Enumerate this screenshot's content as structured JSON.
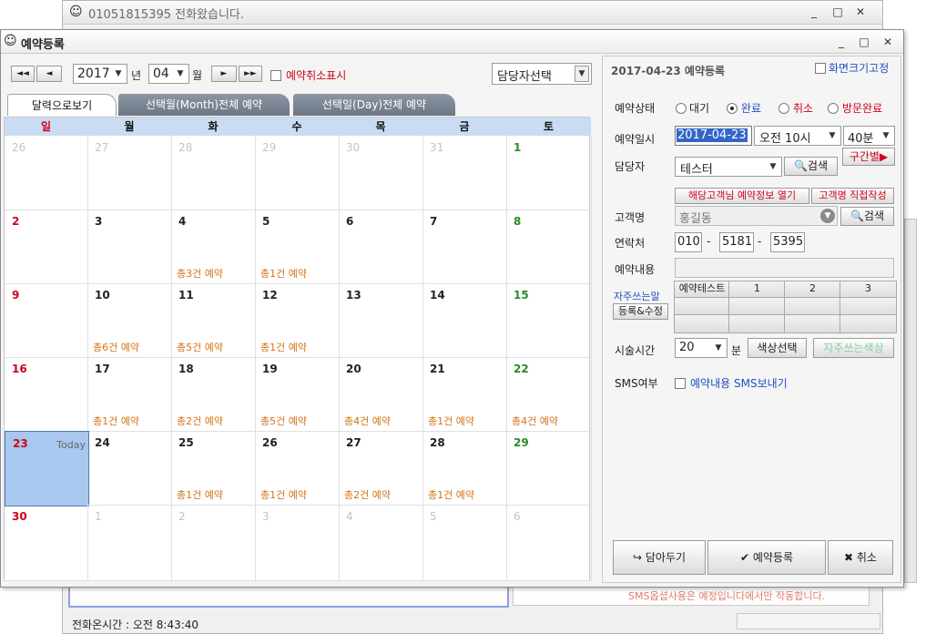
{
  "bg_window": {
    "title": "01051815395 전화왔습니다.",
    "status_label": "전화온시간 : 오전 8:43:40",
    "notice_text": "SMS옵셥사용은 예정입니다에서만 작동합니다."
  },
  "dialog": {
    "title": "예약등록",
    "controls": {
      "minimize": "_",
      "maximize": "□",
      "close": "✕"
    }
  },
  "toolbar": {
    "first_btn": "◄◄",
    "prev_btn": "◄",
    "year": "2017",
    "year_suffix": "년",
    "month": "04",
    "month_suffix": "월",
    "next_btn": "►",
    "last_btn": "►►",
    "cancel_show_label": "예약취소표시",
    "staff_select": "담당자선택"
  },
  "tabs": [
    {
      "label": "달력으로보기"
    },
    {
      "label": "선택월(Month)전체 예약"
    },
    {
      "label": "선택일(Day)전체 예약"
    }
  ],
  "calendar": {
    "weekdays": [
      "일",
      "월",
      "화",
      "수",
      "목",
      "금",
      "토"
    ],
    "weeks": [
      [
        {
          "d": "26",
          "m": "o"
        },
        {
          "d": "27",
          "m": "o"
        },
        {
          "d": "28",
          "m": "o"
        },
        {
          "d": "29",
          "m": "o"
        },
        {
          "d": "30",
          "m": "o"
        },
        {
          "d": "31",
          "m": "o"
        },
        {
          "d": "1",
          "m": "c"
        }
      ],
      [
        {
          "d": "2",
          "m": "c"
        },
        {
          "d": "3",
          "m": "c"
        },
        {
          "d": "4",
          "m": "c",
          "e": "총3건 예약"
        },
        {
          "d": "5",
          "m": "c",
          "e": "총1건 예약"
        },
        {
          "d": "6",
          "m": "c"
        },
        {
          "d": "7",
          "m": "c"
        },
        {
          "d": "8",
          "m": "c"
        }
      ],
      [
        {
          "d": "9",
          "m": "c"
        },
        {
          "d": "10",
          "m": "c",
          "e": "총6건 예약"
        },
        {
          "d": "11",
          "m": "c",
          "e": "총5건 예약"
        },
        {
          "d": "12",
          "m": "c",
          "e": "총1건 예약"
        },
        {
          "d": "13",
          "m": "c"
        },
        {
          "d": "14",
          "m": "c"
        },
        {
          "d": "15",
          "m": "c"
        }
      ],
      [
        {
          "d": "16",
          "m": "c"
        },
        {
          "d": "17",
          "m": "c",
          "e": "총1건 예약"
        },
        {
          "d": "18",
          "m": "c",
          "e": "총2건 예약"
        },
        {
          "d": "19",
          "m": "c",
          "e": "총5건 예약"
        },
        {
          "d": "20",
          "m": "c",
          "e": "총4건 예약"
        },
        {
          "d": "21",
          "m": "c",
          "e": "총1건 예약"
        },
        {
          "d": "22",
          "m": "c",
          "e": "총4건 예약"
        }
      ],
      [
        {
          "d": "23",
          "m": "c",
          "t": "Today"
        },
        {
          "d": "24",
          "m": "c"
        },
        {
          "d": "25",
          "m": "c",
          "e": "총1건 예약"
        },
        {
          "d": "26",
          "m": "c",
          "e": "총1건 예약"
        },
        {
          "d": "27",
          "m": "c",
          "e": "총2건 예약"
        },
        {
          "d": "28",
          "m": "c",
          "e": "총1건 예약"
        },
        {
          "d": "29",
          "m": "c"
        }
      ],
      [
        {
          "d": "30",
          "m": "c"
        },
        {
          "d": "1",
          "m": "o"
        },
        {
          "d": "2",
          "m": "o"
        },
        {
          "d": "3",
          "m": "o"
        },
        {
          "d": "4",
          "m": "o"
        },
        {
          "d": "5",
          "m": "o"
        },
        {
          "d": "6",
          "m": "o"
        }
      ]
    ]
  },
  "form": {
    "header_title": "2017-04-23 예약등록",
    "fix_size_label": "화면크기고정",
    "status_label": "예약상태",
    "status_options": [
      "대기",
      "완료",
      "취소",
      "방문완료"
    ],
    "status_selected": "완료",
    "datetime_label": "예약일시",
    "date_value": "2017-04-23",
    "hour_value": "오전 10시",
    "minute_value": "40분",
    "range_btn": "구간별▶",
    "staff_label": "담당자",
    "staff_value": "테스터",
    "search_btn": "검색",
    "customer_info_btn": "해당고객님 예약정보 열기",
    "customer_direct_btn": "고객명 직접작성",
    "customer_label": "고객명",
    "customer_value": "홍길동",
    "phone_label": "연락처",
    "phone": [
      "010",
      "5181",
      "5395"
    ],
    "content_label": "예약내용",
    "content_value": "",
    "quick_phrase_label": "자주쓰는말",
    "quick_register_btn": "등록&수정",
    "quick_grid": [
      "예약테스트",
      "1",
      "2",
      "3",
      "",
      "",
      "",
      "",
      "",
      "",
      "",
      ""
    ],
    "duration_label": "시술시간",
    "duration_value": "20",
    "duration_unit": "분",
    "color_select_btn": "색상선택",
    "quick_color_btn": "자주쓰는색상",
    "sms_label": "SMS여부",
    "sms_check_label": "예약내용 SMS보내기",
    "hold_btn": "담아두기",
    "register_btn": "예약등록",
    "cancel_btn": "취소"
  },
  "colors": {
    "sunday": "#d0021b",
    "saturday": "#2a8a2a",
    "other_month": "#c4c4c4",
    "event": "#d27315",
    "today_bg": "#a9c8ef",
    "header_bg": "#c9dcf2",
    "accent_blue": "#1f4fbf"
  },
  "icons": {
    "smile": "smile-icon",
    "search": "search-icon",
    "check": "check-icon",
    "close": "close-icon",
    "hold": "return-arrow-icon"
  }
}
